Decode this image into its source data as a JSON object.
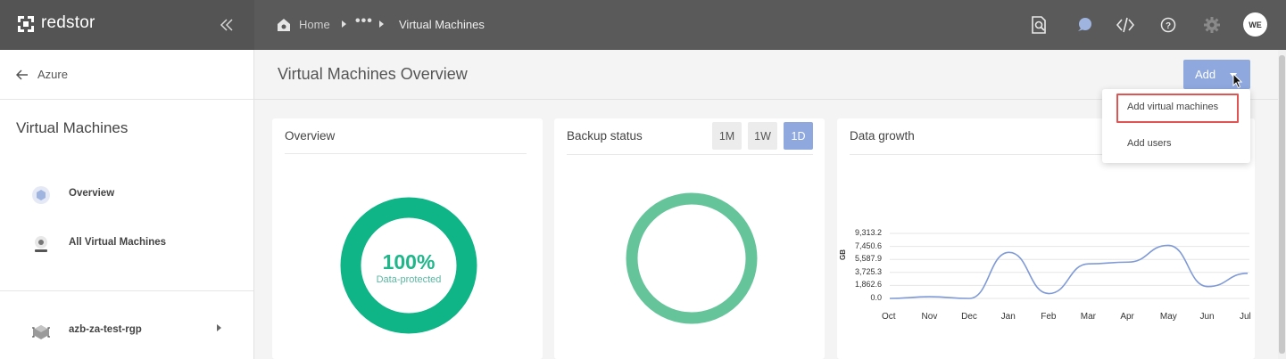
{
  "app": {
    "name": "redstor"
  },
  "breadcrumb": {
    "home": "Home",
    "ellipsis": "•••",
    "current": "Virtual Machines"
  },
  "user": {
    "initials": "WE"
  },
  "sidebar": {
    "back_label": "Azure",
    "title": "Virtual Machines",
    "items": [
      {
        "label": "Overview"
      },
      {
        "label": "All Virtual Machines"
      },
      {
        "label": "azb-za-test-rgp"
      }
    ]
  },
  "page": {
    "title": "Virtual Machines Overview",
    "add_label": "Add"
  },
  "dropdown": {
    "items": [
      {
        "label": "Add virtual machines"
      },
      {
        "label": "Add users"
      }
    ]
  },
  "cards": {
    "overview": {
      "title": "Overview",
      "percent": "100%",
      "subtitle": "Data-protected"
    },
    "backup": {
      "title": "Backup status",
      "ranges": [
        "1M",
        "1W",
        "1D"
      ],
      "active_range": "1D"
    },
    "growth": {
      "title": "Data growth"
    }
  },
  "colors": {
    "accent": "#8fa9df",
    "donut_green": "#0fb487",
    "donut_light": "#66c49b",
    "line": "#7f9ad6",
    "highlight": "#e05454"
  },
  "chart_data": {
    "type": "line",
    "title": "Data growth",
    "xlabel": "",
    "ylabel": "GB",
    "categories": [
      "Oct",
      "Nov",
      "Dec",
      "Jan",
      "Feb",
      "Mar",
      "Apr",
      "May",
      "Jun",
      "Jul"
    ],
    "y_ticks": [
      "0.0",
      "1,862.6",
      "3,725.3",
      "5,587.9",
      "7,450.6",
      "9,313.2"
    ],
    "ylim": [
      0,
      9313.2
    ],
    "series": [
      {
        "values": [
          0,
          250,
          0,
          6600,
          700,
          4950,
          5200,
          7600,
          1700,
          3600
        ]
      }
    ],
    "grid": true
  }
}
